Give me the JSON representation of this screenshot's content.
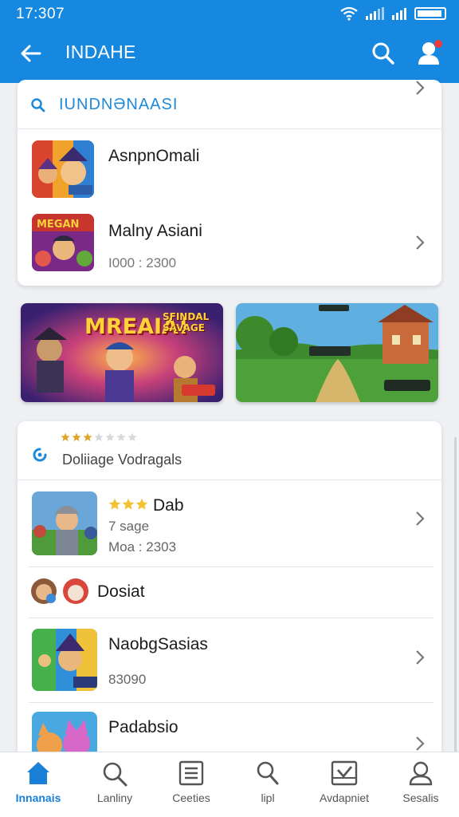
{
  "status_bar": {
    "time": "17:307"
  },
  "appbar": {
    "title": "INDAHE"
  },
  "search": {
    "label": "IUNDNƏNAASI"
  },
  "list1": [
    {
      "title": "AsnpnOmali",
      "meta": ""
    },
    {
      "title": "Malny Asiani",
      "meta": "I000 : 2300"
    }
  ],
  "banners": [
    {
      "headline": "MREAIA!",
      "side_text": "SFINDAL SAVAGE",
      "badge": ""
    },
    {
      "headline": "",
      "side_text": "",
      "badge": ""
    }
  ],
  "section2": {
    "label": "Doliiage Vodragals",
    "rating": 3,
    "max_rating": 7
  },
  "list2": [
    {
      "title": "Dab",
      "line2": "7 sage",
      "line3": "Moa : 2303",
      "rating": 3
    },
    {
      "title": "Dosiat"
    },
    {
      "title": "NaobgSasias",
      "meta": "83090"
    },
    {
      "title": "Padabsio"
    }
  ],
  "bottom_nav": [
    {
      "label": "Innanais",
      "icon": "home-icon",
      "active": true
    },
    {
      "label": "Lanliny",
      "icon": "search-icon",
      "active": false
    },
    {
      "label": "Ceeties",
      "icon": "list-icon",
      "active": false
    },
    {
      "label": "lipl",
      "icon": "magnifier-icon",
      "active": false
    },
    {
      "label": "Avdapniet",
      "icon": "inbox-check-icon",
      "active": false
    },
    {
      "label": "Sesalis",
      "icon": "profile-icon",
      "active": false
    }
  ],
  "colors": {
    "primary": "#1788e0",
    "accent_text": "#1f8ad8",
    "star": "#e0a526"
  }
}
